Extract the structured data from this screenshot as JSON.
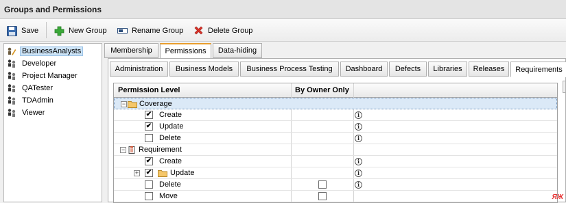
{
  "window": {
    "title": "Groups and Permissions"
  },
  "toolbar": {
    "save_label": "Save",
    "new_group_label": "New Group",
    "rename_group_label": "Rename Group",
    "delete_group_label": "Delete Group"
  },
  "groups": [
    {
      "label": "BusinessAnalysts",
      "selected": true
    },
    {
      "label": "Developer"
    },
    {
      "label": "Project Manager"
    },
    {
      "label": "QATester"
    },
    {
      "label": "TDAdmin"
    },
    {
      "label": "Viewer"
    }
  ],
  "top_tabs": [
    {
      "label": "Membership"
    },
    {
      "label": "Permissions",
      "active": true
    },
    {
      "label": "Data-hiding"
    }
  ],
  "module_tabs": [
    {
      "label": "Administration"
    },
    {
      "label": "Business Models"
    },
    {
      "label": "Business Process Testing"
    },
    {
      "label": "Dashboard"
    },
    {
      "label": "Defects"
    },
    {
      "label": "Libraries"
    },
    {
      "label": "Releases"
    },
    {
      "label": "Requirements",
      "active": true
    }
  ],
  "grid": {
    "headers": {
      "permission_level": "Permission Level",
      "by_owner_only": "By Owner Only"
    },
    "rows": [
      {
        "label": "Coverage",
        "type": "folder-group",
        "expanded": true,
        "selected": true
      },
      {
        "label": "Create",
        "checked": true
      },
      {
        "label": "Update",
        "checked": true
      },
      {
        "label": "Delete",
        "checked": false
      },
      {
        "label": "Requirement",
        "type": "entity-group",
        "expanded": true
      },
      {
        "label": "Create",
        "checked": true
      },
      {
        "label": "Update",
        "checked": true,
        "folder": true,
        "expandable": true
      },
      {
        "label": "Delete",
        "checked": false,
        "owner": true
      },
      {
        "label": "Move",
        "checked": false,
        "owner": true
      }
    ],
    "expander_collapsed": "+",
    "expander_expanded": "−",
    "check_glyph": "✔",
    "info_glyph": "i"
  },
  "watermark": "ЯЖ"
}
